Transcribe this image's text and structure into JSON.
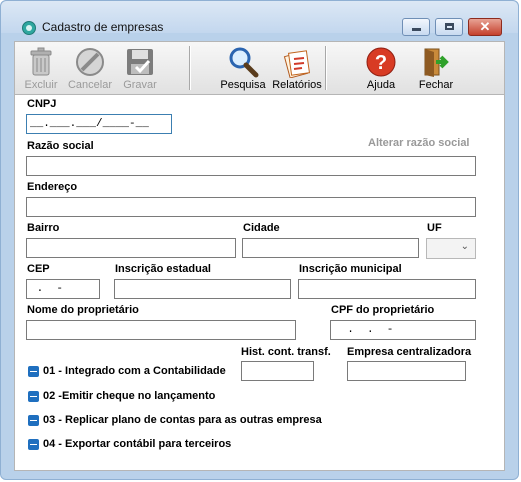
{
  "window": {
    "title": "Cadastro de empresas",
    "close_glyph": "✕"
  },
  "toolbar": {
    "items": [
      {
        "label": "Excluir",
        "icon": "trash-icon",
        "enabled": false
      },
      {
        "label": "Cancelar",
        "icon": "cancel-icon",
        "enabled": false
      },
      {
        "label": "Gravar",
        "icon": "save-icon",
        "enabled": false
      },
      {
        "label": "Pesquisa",
        "icon": "magnifier-icon",
        "enabled": true
      },
      {
        "label": "Relatórios",
        "icon": "report-icon",
        "enabled": true
      },
      {
        "label": "Ajuda",
        "icon": "help-icon",
        "enabled": true
      },
      {
        "label": "Fechar",
        "icon": "exit-door-icon",
        "enabled": true
      }
    ]
  },
  "form": {
    "cnpj": {
      "label": "CNPJ",
      "value": "__.___.___/____-__"
    },
    "razao_social": {
      "label": "Razão social",
      "value": "",
      "alter_link": "Alterar razão social"
    },
    "endereco": {
      "label": "Endereço",
      "value": ""
    },
    "bairro": {
      "label": "Bairro",
      "value": ""
    },
    "cidade": {
      "label": "Cidade",
      "value": ""
    },
    "uf": {
      "label": "UF",
      "value": "",
      "chevron": "⌄"
    },
    "cep": {
      "label": "CEP",
      "value": " .  -"
    },
    "inscricao_estadual": {
      "label": "Inscrição estadual",
      "value": ""
    },
    "inscricao_municipal": {
      "label": "Inscrição municipal",
      "value": ""
    },
    "nome_proprietario": {
      "label": "Nome do proprietário",
      "value": ""
    },
    "cpf_proprietario": {
      "label": "CPF do proprietário",
      "value": "  .  .  -"
    },
    "hist_cont_transf": {
      "label": "Hist. cont. transf.",
      "value": ""
    },
    "empresa_centralizadora": {
      "label": "Empresa centralizadora",
      "value": ""
    },
    "options": [
      {
        "label": "01 - Integrado com a Contabilidade",
        "checked": false
      },
      {
        "label": "02 -Emitir cheque no lançamento",
        "checked": false
      },
      {
        "label": "03 - Replicar plano de contas para as outras empresa",
        "checked": false
      },
      {
        "label": "04 -  Exportar contábil para terceiros",
        "checked": false
      }
    ]
  },
  "colors": {
    "checkbox": "#1f6fbf",
    "link_disabled": "#999999",
    "close_button": "#c4402c",
    "window_frame": "#b9d1ea"
  }
}
